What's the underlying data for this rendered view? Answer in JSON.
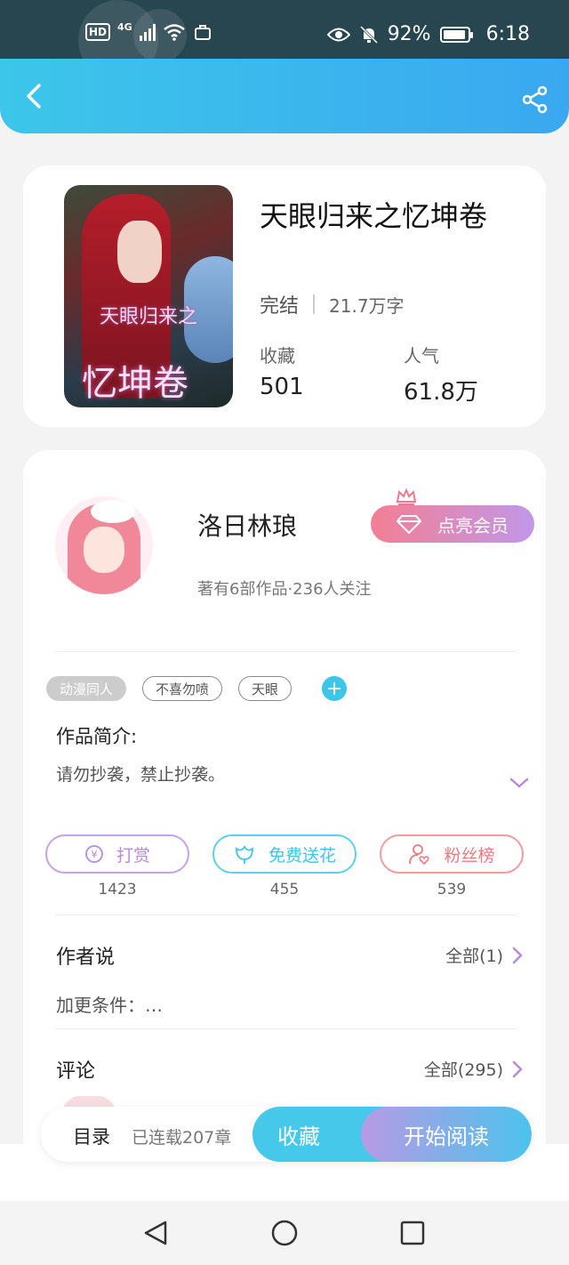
{
  "status_bar": {
    "network": "4G",
    "hd": "HD",
    "battery": "92%",
    "battery_level": 0.92,
    "time": "6:18"
  },
  "header": {
    "back_icon": "chevron-left-icon",
    "share_icon": "share-icon",
    "colors": {
      "from": "#3cc6ea",
      "to": "#3aa8f0"
    }
  },
  "book": {
    "title": "天眼归来之忆坤卷",
    "cover_text_top": "天眼归来之",
    "cover_text_big": "忆坤卷",
    "status": "完结",
    "words": "21.7万字",
    "collect_label": "收藏",
    "collect_value": "501",
    "popularity_label": "人气",
    "popularity_value": "61.8万"
  },
  "author": {
    "name": "洛日林琅",
    "info": "著有6部作品·236人关注",
    "vip_label": "点亮会员"
  },
  "tags": [
    "动漫同人",
    "不喜勿喷",
    "天眼"
  ],
  "intro": {
    "title": "作品简介:",
    "text": "请勿抄袭，禁止抄袭。"
  },
  "actions": [
    {
      "label": "打赏",
      "count": "1423",
      "icon": "coin-icon",
      "color": "#b58ae0"
    },
    {
      "label": "免费送花",
      "count": "455",
      "icon": "flower-icon",
      "color": "#3cc6ea"
    },
    {
      "label": "粉丝榜",
      "count": "539",
      "icon": "fan-icon",
      "color": "#f07880"
    }
  ],
  "author_says": {
    "title": "作者说",
    "more": "全部(1)",
    "preview": "加更条件：…"
  },
  "comments": {
    "title": "评论",
    "more": "全部(295)"
  },
  "bottom_bar": {
    "toc": "目录",
    "updates": "已连载207章",
    "collect": "收藏",
    "read": "开始阅读"
  }
}
